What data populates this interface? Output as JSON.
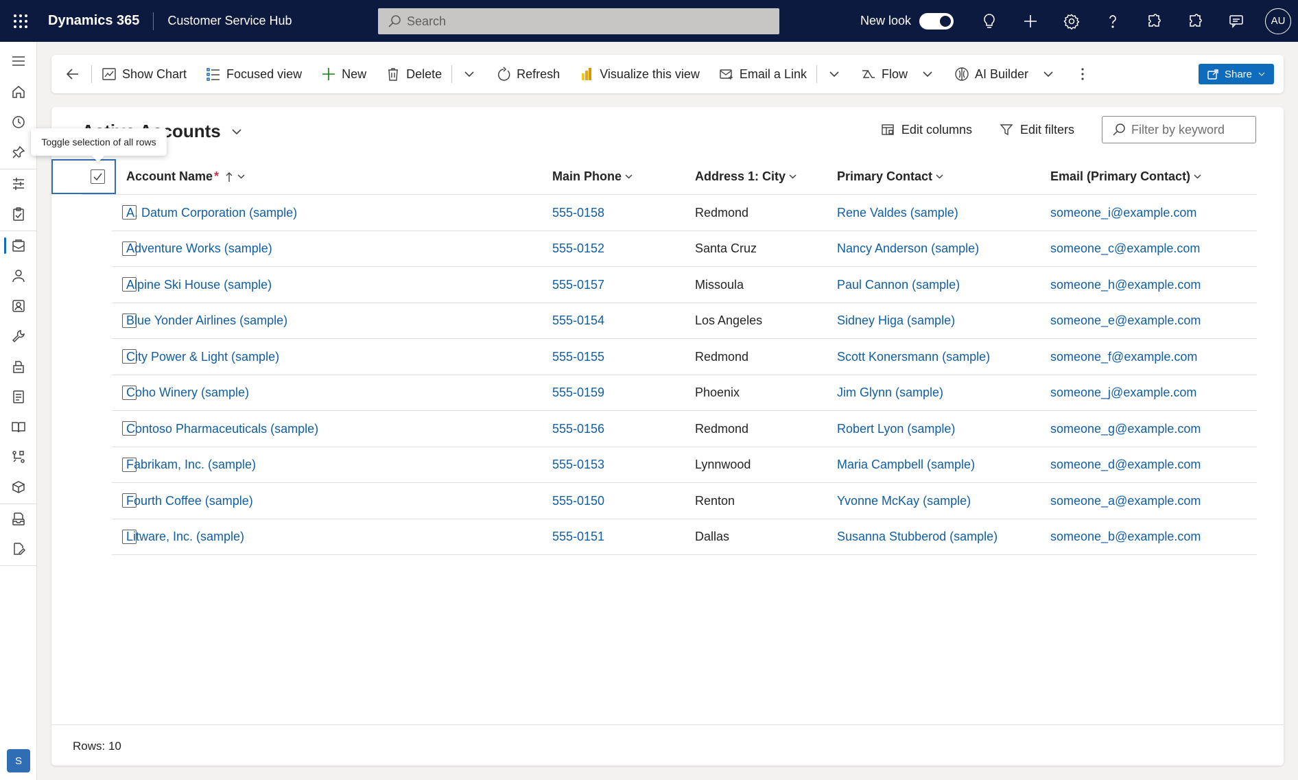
{
  "topbar": {
    "brand": "Dynamics 365",
    "app_name": "Customer Service Hub",
    "search_placeholder": "Search",
    "new_look_label": "New look",
    "avatar_initials": "AU"
  },
  "commands": {
    "show_chart": "Show Chart",
    "focused_view": "Focused view",
    "new": "New",
    "delete": "Delete",
    "refresh": "Refresh",
    "visualize": "Visualize this view",
    "email_link": "Email a Link",
    "flow": "Flow",
    "ai_builder": "AI Builder",
    "share": "Share"
  },
  "view": {
    "title": "Active Accounts",
    "edit_columns": "Edit columns",
    "edit_filters": "Edit filters",
    "filter_placeholder": "Filter by keyword",
    "tooltip": "Toggle selection of all rows"
  },
  "columns": {
    "account_name": "Account Name",
    "required_marker": "*",
    "main_phone": "Main Phone",
    "city": "Address 1: City",
    "primary_contact": "Primary Contact",
    "email": "Email (Primary Contact)"
  },
  "rows": [
    {
      "name": "A. Datum Corporation (sample)",
      "phone": "555-0158",
      "city": "Redmond",
      "contact": "Rene Valdes (sample)",
      "email": "someone_i@example.com"
    },
    {
      "name": "Adventure Works (sample)",
      "phone": "555-0152",
      "city": "Santa Cruz",
      "contact": "Nancy Anderson (sample)",
      "email": "someone_c@example.com"
    },
    {
      "name": "Alpine Ski House (sample)",
      "phone": "555-0157",
      "city": "Missoula",
      "contact": "Paul Cannon (sample)",
      "email": "someone_h@example.com"
    },
    {
      "name": "Blue Yonder Airlines (sample)",
      "phone": "555-0154",
      "city": "Los Angeles",
      "contact": "Sidney Higa (sample)",
      "email": "someone_e@example.com"
    },
    {
      "name": "City Power & Light (sample)",
      "phone": "555-0155",
      "city": "Redmond",
      "contact": "Scott Konersmann (sample)",
      "email": "someone_f@example.com"
    },
    {
      "name": "Coho Winery (sample)",
      "phone": "555-0159",
      "city": "Phoenix",
      "contact": "Jim Glynn (sample)",
      "email": "someone_j@example.com"
    },
    {
      "name": "Contoso Pharmaceuticals (sample)",
      "phone": "555-0156",
      "city": "Redmond",
      "contact": "Robert Lyon (sample)",
      "email": "someone_g@example.com"
    },
    {
      "name": "Fabrikam, Inc. (sample)",
      "phone": "555-0153",
      "city": "Lynnwood",
      "contact": "Maria Campbell (sample)",
      "email": "someone_d@example.com"
    },
    {
      "name": "Fourth Coffee (sample)",
      "phone": "555-0150",
      "city": "Renton",
      "contact": "Yvonne McKay (sample)",
      "email": "someone_a@example.com"
    },
    {
      "name": "Litware, Inc. (sample)",
      "phone": "555-0151",
      "city": "Dallas",
      "contact": "Susanna Stubberod (sample)",
      "email": "someone_b@example.com"
    }
  ],
  "footer": {
    "rows_label": "Rows: 10"
  },
  "area_switcher": "S",
  "colors": {
    "topbar_bg": "#0b1a3e",
    "link": "#115ea3",
    "accent": "#0f6cbd"
  }
}
